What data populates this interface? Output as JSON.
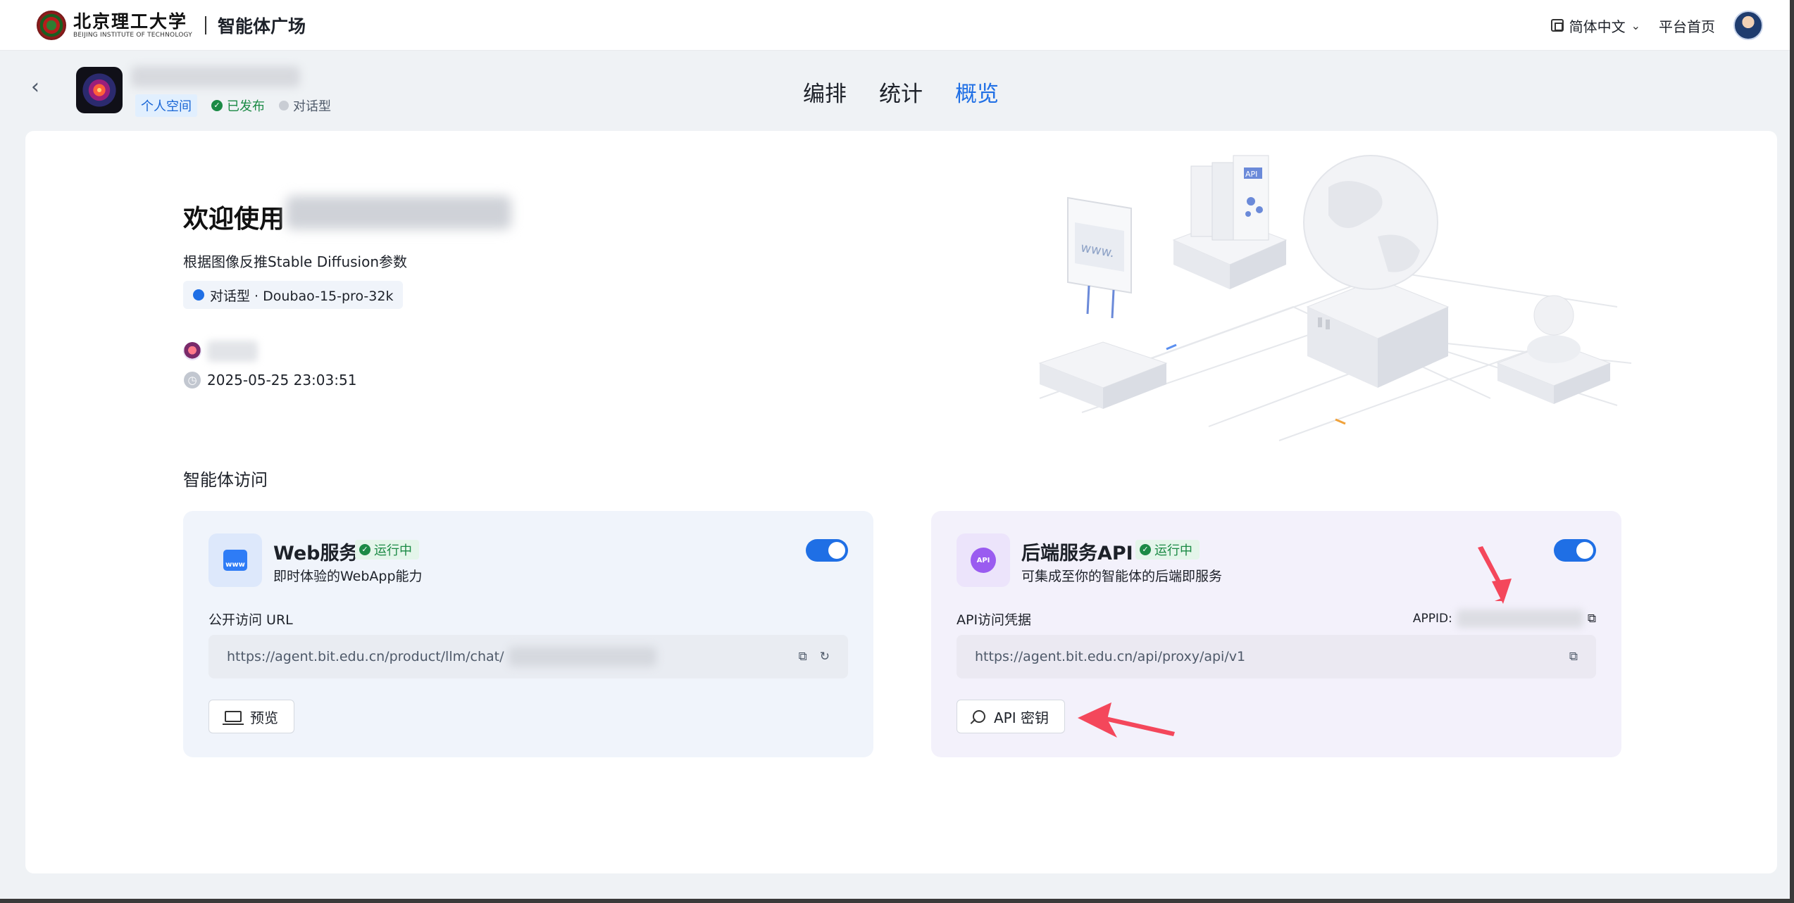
{
  "topbar": {
    "school_cn": "北京理工大学",
    "school_en": "BEIJING INSTITUTE OF TECHNOLOGY",
    "brand_title": "智能体广场",
    "language": "简体中文",
    "home_link": "平台首页",
    "icons": [
      "school-logo",
      "language-icon",
      "chevron-down-icon",
      "user-avatar"
    ]
  },
  "agent_header": {
    "tags": {
      "space": "个人空间",
      "published": "已发布",
      "type": "对话型"
    },
    "tabs": [
      "编排",
      "统计",
      "概览"
    ],
    "active_tab": "概览"
  },
  "overview": {
    "welcome_prefix": "欢迎使用",
    "description": "根据图像反推Stable Diffusion参数",
    "model_chip": "对话型 · Doubao-15-pro-32k",
    "created_at": "2025-05-25 23:03:51"
  },
  "access": {
    "section_title": "智能体访问",
    "web": {
      "title": "Web服务",
      "status": "运行中",
      "subtitle": "即时体验的WebApp能力",
      "field_label": "公开访问 URL",
      "url": "https://agent.bit.edu.cn/product/llm/chat/",
      "button": "预览",
      "icon_text": "www",
      "enabled": true
    },
    "api": {
      "title": "后端服务API",
      "status": "运行中",
      "subtitle": "可集成至你的智能体的后端即服务",
      "field_label": "API访问凭据",
      "appid_label": "APPID:",
      "url": "https://agent.bit.edu.cn/api/proxy/api/v1",
      "button": "API 密钥",
      "icon_text": "API",
      "enabled": true
    }
  },
  "colors": {
    "accent": "#1f6fe5",
    "success": "#1b8a45",
    "annotation": "#f4475b"
  }
}
